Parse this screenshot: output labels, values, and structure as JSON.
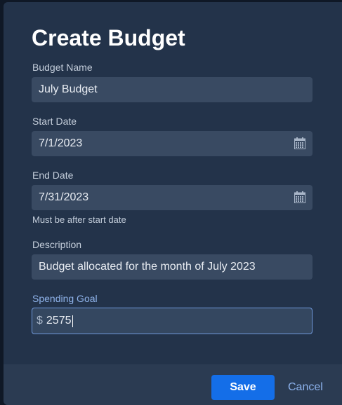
{
  "dialog": {
    "title": "Create Budget"
  },
  "fields": {
    "budget_name": {
      "label": "Budget Name",
      "value": "July Budget"
    },
    "start_date": {
      "label": "Start Date",
      "value": "7/1/2023",
      "icon": "calendar-icon"
    },
    "end_date": {
      "label": "End Date",
      "value": "7/31/2023",
      "icon": "calendar-icon",
      "helper": "Must be after start date"
    },
    "description": {
      "label": "Description",
      "value": "Budget allocated for the month of July 2023"
    },
    "spending_goal": {
      "label": "Spending Goal",
      "currency_symbol": "$",
      "value": "2575"
    }
  },
  "footer": {
    "save_label": "Save",
    "cancel_label": "Cancel"
  },
  "colors": {
    "background": "#23334a",
    "input": "#394a62",
    "accent": "#146ee8",
    "focus_label": "#8fb3ea"
  }
}
